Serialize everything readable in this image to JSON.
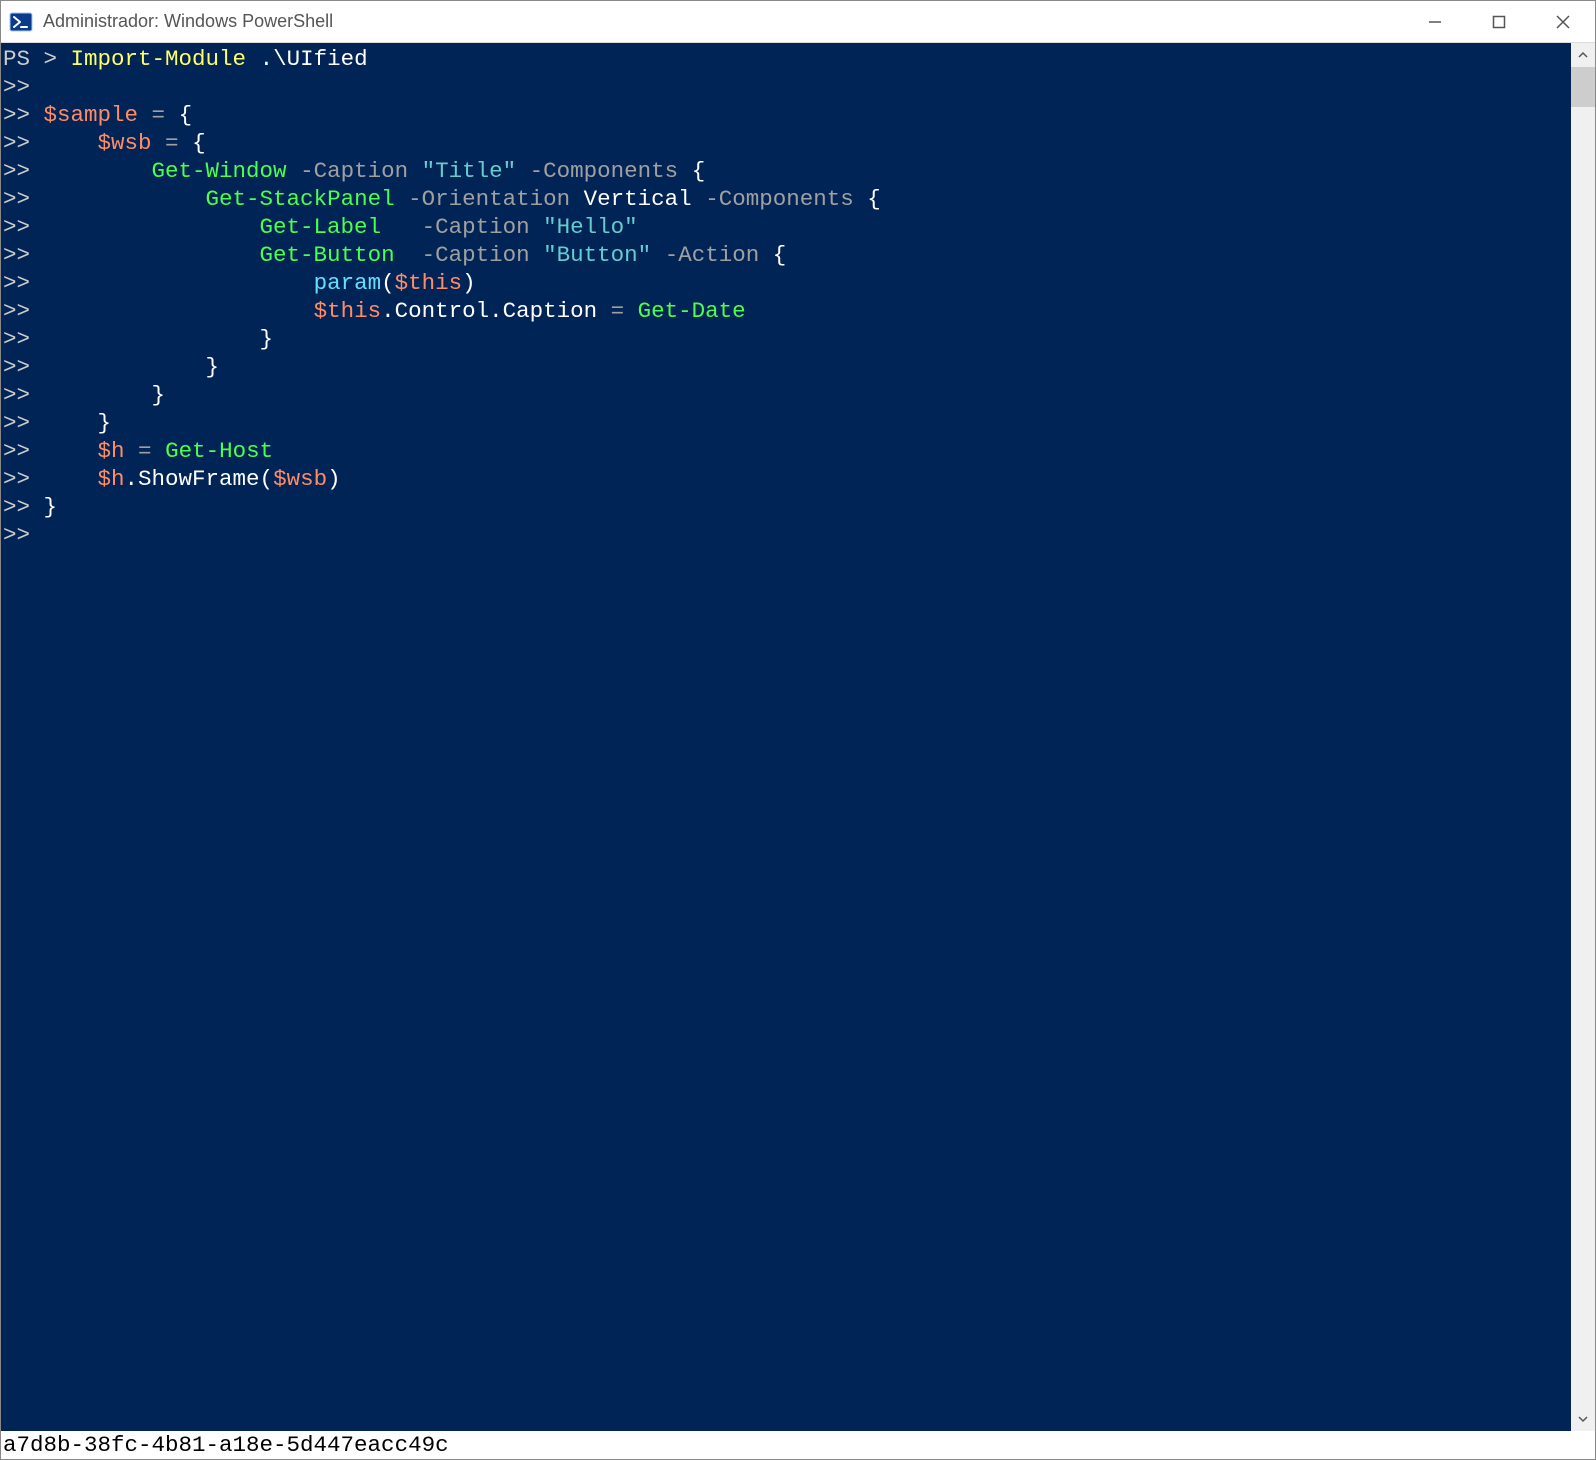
{
  "window": {
    "title": "Administrador: Windows PowerShell"
  },
  "footer": {
    "text": "a7d8b-38fc-4b81-a18e-5d447eacc49c"
  },
  "code": {
    "lines": [
      {
        "prompt": "PS > ",
        "tokens": [
          {
            "t": "Import-Module",
            "c": "yellow"
          },
          {
            "t": " ",
            "c": "white"
          },
          {
            "t": ".\\UIfied",
            "c": "white"
          }
        ]
      },
      {
        "prompt": ">>",
        "tokens": []
      },
      {
        "prompt": ">> ",
        "tokens": [
          {
            "t": "$sample",
            "c": "orange"
          },
          {
            "t": " ",
            "c": "white"
          },
          {
            "t": "=",
            "c": "gray"
          },
          {
            "t": " ",
            "c": "white"
          },
          {
            "t": "{",
            "c": "white"
          }
        ]
      },
      {
        "prompt": ">>     ",
        "tokens": [
          {
            "t": "$wsb",
            "c": "orange"
          },
          {
            "t": " ",
            "c": "white"
          },
          {
            "t": "=",
            "c": "gray"
          },
          {
            "t": " ",
            "c": "white"
          },
          {
            "t": "{",
            "c": "white"
          }
        ]
      },
      {
        "prompt": ">>         ",
        "tokens": [
          {
            "t": "Get-Window",
            "c": "green"
          },
          {
            "t": " ",
            "c": "white"
          },
          {
            "t": "-Caption",
            "c": "gray"
          },
          {
            "t": " ",
            "c": "white"
          },
          {
            "t": "\"Title\"",
            "c": "teal"
          },
          {
            "t": " ",
            "c": "white"
          },
          {
            "t": "-Components",
            "c": "gray"
          },
          {
            "t": " ",
            "c": "white"
          },
          {
            "t": "{",
            "c": "white"
          }
        ]
      },
      {
        "prompt": ">>             ",
        "tokens": [
          {
            "t": "Get-StackPanel",
            "c": "green"
          },
          {
            "t": " ",
            "c": "white"
          },
          {
            "t": "-Orientation",
            "c": "gray"
          },
          {
            "t": " ",
            "c": "white"
          },
          {
            "t": "Vertical",
            "c": "white"
          },
          {
            "t": " ",
            "c": "white"
          },
          {
            "t": "-Components",
            "c": "gray"
          },
          {
            "t": " ",
            "c": "white"
          },
          {
            "t": "{",
            "c": "white"
          }
        ]
      },
      {
        "prompt": ">>                 ",
        "tokens": [
          {
            "t": "Get-Label",
            "c": "green"
          },
          {
            "t": "   ",
            "c": "white"
          },
          {
            "t": "-Caption",
            "c": "gray"
          },
          {
            "t": " ",
            "c": "white"
          },
          {
            "t": "\"Hello\"",
            "c": "teal"
          }
        ]
      },
      {
        "prompt": ">>                 ",
        "tokens": [
          {
            "t": "Get-Button",
            "c": "green"
          },
          {
            "t": "  ",
            "c": "white"
          },
          {
            "t": "-Caption",
            "c": "gray"
          },
          {
            "t": " ",
            "c": "white"
          },
          {
            "t": "\"Button\"",
            "c": "teal"
          },
          {
            "t": " ",
            "c": "white"
          },
          {
            "t": "-Action",
            "c": "gray"
          },
          {
            "t": " ",
            "c": "white"
          },
          {
            "t": "{",
            "c": "white"
          }
        ]
      },
      {
        "prompt": ">>                     ",
        "tokens": [
          {
            "t": "param",
            "c": "cyan"
          },
          {
            "t": "(",
            "c": "white"
          },
          {
            "t": "$this",
            "c": "orange"
          },
          {
            "t": ")",
            "c": "white"
          }
        ]
      },
      {
        "prompt": ">>                     ",
        "tokens": [
          {
            "t": "$this",
            "c": "orange"
          },
          {
            "t": ".Control.Caption ",
            "c": "white"
          },
          {
            "t": "=",
            "c": "gray"
          },
          {
            "t": " ",
            "c": "white"
          },
          {
            "t": "Get-Date",
            "c": "green"
          }
        ]
      },
      {
        "prompt": ">>                 ",
        "tokens": [
          {
            "t": "}",
            "c": "white"
          }
        ]
      },
      {
        "prompt": ">>             ",
        "tokens": [
          {
            "t": "}",
            "c": "white"
          }
        ]
      },
      {
        "prompt": ">>         ",
        "tokens": [
          {
            "t": "}",
            "c": "white"
          }
        ]
      },
      {
        "prompt": ">>     ",
        "tokens": [
          {
            "t": "}",
            "c": "white"
          }
        ]
      },
      {
        "prompt": ">>     ",
        "tokens": [
          {
            "t": "$h",
            "c": "orange"
          },
          {
            "t": " ",
            "c": "white"
          },
          {
            "t": "=",
            "c": "gray"
          },
          {
            "t": " ",
            "c": "white"
          },
          {
            "t": "Get-Host",
            "c": "green"
          }
        ]
      },
      {
        "prompt": ">>     ",
        "tokens": [
          {
            "t": "$h",
            "c": "orange"
          },
          {
            "t": ".ShowFrame(",
            "c": "white"
          },
          {
            "t": "$wsb",
            "c": "orange"
          },
          {
            "t": ")",
            "c": "white"
          }
        ]
      },
      {
        "prompt": ">> ",
        "tokens": [
          {
            "t": "}",
            "c": "white"
          }
        ]
      },
      {
        "prompt": ">>",
        "tokens": []
      }
    ]
  }
}
